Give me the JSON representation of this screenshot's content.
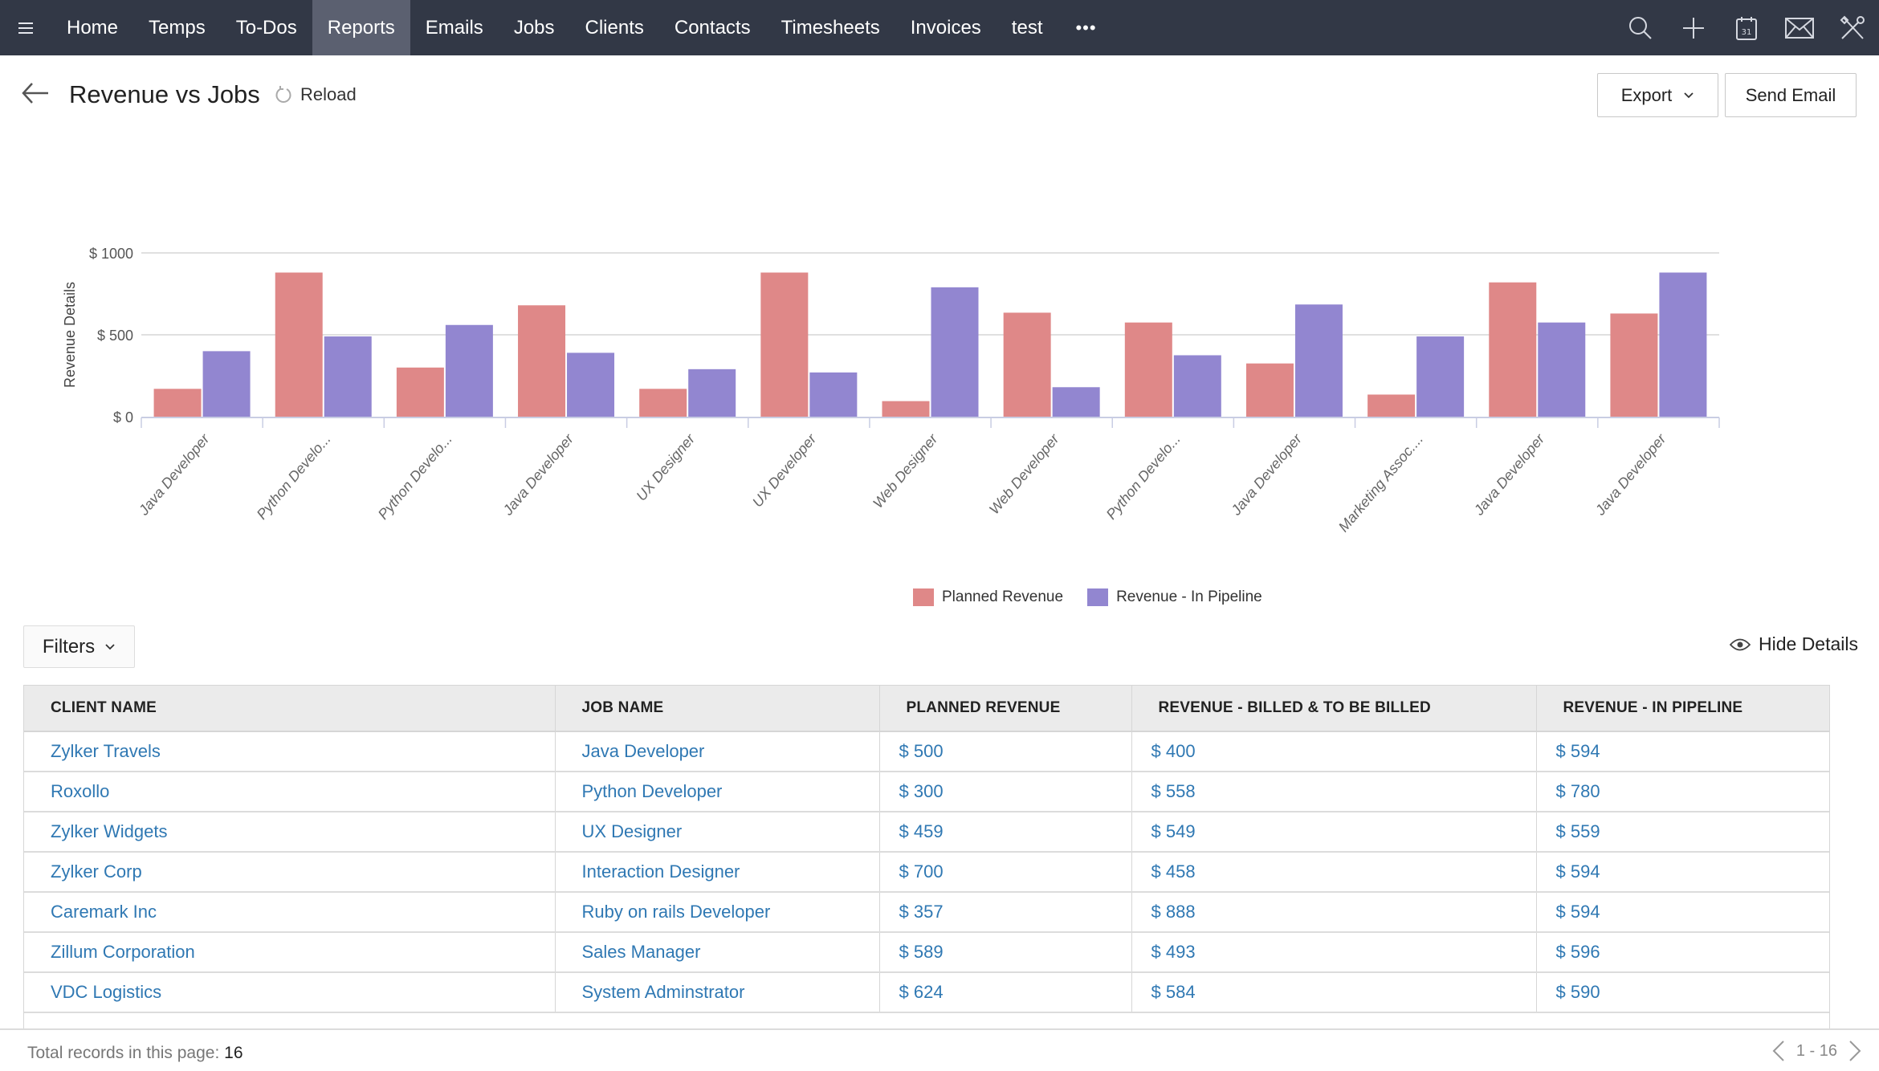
{
  "nav": {
    "menu_icon": "hamburger-icon",
    "items": [
      {
        "label": "Home",
        "active": false
      },
      {
        "label": "Temps",
        "active": false
      },
      {
        "label": "To-Dos",
        "active": false
      },
      {
        "label": "Reports",
        "active": true
      },
      {
        "label": "Emails",
        "active": false
      },
      {
        "label": "Jobs",
        "active": false
      },
      {
        "label": "Clients",
        "active": false
      },
      {
        "label": "Contacts",
        "active": false
      },
      {
        "label": "Timesheets",
        "active": false
      },
      {
        "label": "Invoices",
        "active": false
      },
      {
        "label": "test",
        "active": false
      }
    ],
    "more_label": "•••",
    "right_icons": [
      "search-icon",
      "plus-icon",
      "calendar-icon",
      "mail-icon",
      "tools-icon"
    ],
    "calendar_day": "31"
  },
  "header": {
    "title": "Revenue vs Jobs",
    "reload_label": "Reload",
    "export_label": "Export",
    "send_email_label": "Send Email"
  },
  "chart_data": {
    "type": "bar",
    "title": "",
    "xlabel": "",
    "ylabel": "Revenue Details",
    "ylim": [
      0,
      1000
    ],
    "yticks": [
      "$ 0",
      "$ 500",
      "$ 1000"
    ],
    "ytick_values": [
      0,
      500,
      1000
    ],
    "grid": true,
    "legend_position": "bottom-center",
    "categories": [
      "Java Developer",
      "Python Develo...",
      "Python Develo...",
      "Java Developer",
      "UX Designer",
      "UX Developer",
      "Web Designer",
      "Web Developer",
      "Python Develo...",
      "Java Developer",
      "Marketing Assoc....",
      "Java Developer",
      "Java Developer"
    ],
    "series": [
      {
        "name": "Planned Revenue",
        "color": "#df8888",
        "values": [
          170,
          880,
          300,
          680,
          170,
          880,
          95,
          635,
          575,
          325,
          135,
          820,
          630
        ]
      },
      {
        "name": "Revenue - In Pipeline",
        "color": "#9286d0",
        "values": [
          400,
          490,
          560,
          390,
          290,
          270,
          790,
          180,
          375,
          685,
          490,
          575,
          880
        ]
      }
    ]
  },
  "filters": {
    "label": "Filters",
    "hide_details_label": "Hide Details"
  },
  "table": {
    "columns": [
      "CLIENT NAME",
      "JOB NAME",
      "PLANNED REVENUE",
      "REVENUE - BILLED & TO BE BILLED",
      "REVENUE - IN PIPELINE"
    ],
    "rows": [
      [
        "Zylker Travels",
        "Java Developer",
        "$ 500",
        "$ 400",
        "$ 594"
      ],
      [
        "Roxollo",
        "Python Developer",
        "$ 300",
        "$ 558",
        "$ 780"
      ],
      [
        "Zylker Widgets",
        "UX Designer",
        "$ 459",
        "$ 549",
        "$ 559"
      ],
      [
        "Zylker Corp",
        "Interaction Designer",
        "$ 700",
        "$ 458",
        "$ 594"
      ],
      [
        "Caremark Inc",
        "Ruby on rails Developer",
        "$ 357",
        "$ 888",
        "$ 594"
      ],
      [
        "Zillum Corporation",
        "Sales Manager",
        "$ 589",
        "$ 493",
        "$ 596"
      ],
      [
        "VDC Logistics",
        "System Adminstrator",
        "$ 624",
        "$ 584",
        "$ 590"
      ]
    ]
  },
  "footer": {
    "total_label": "Total records in this page:",
    "total_value": "16",
    "page_range": "1 - 16"
  }
}
